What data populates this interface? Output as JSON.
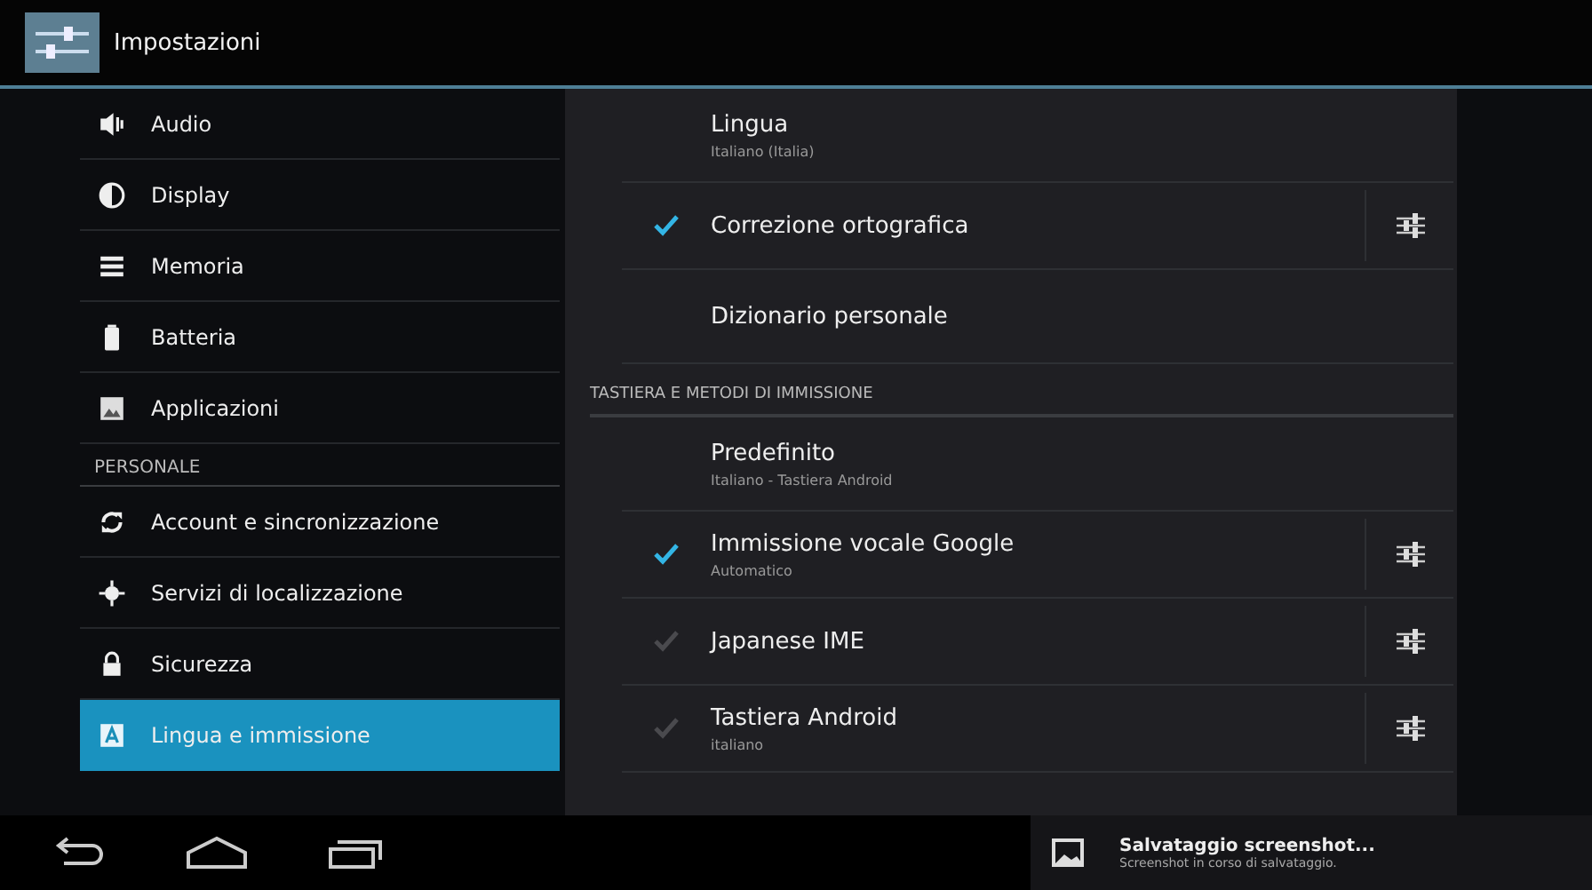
{
  "app_bar": {
    "title": "Impostazioni"
  },
  "sidebar": {
    "items": [
      {
        "kind": "item",
        "label": "Audio",
        "selected": false
      },
      {
        "kind": "item",
        "label": "Display",
        "selected": false
      },
      {
        "kind": "item",
        "label": "Memoria",
        "selected": false
      },
      {
        "kind": "item",
        "label": "Batteria",
        "selected": false
      },
      {
        "kind": "item",
        "label": "Applicazioni",
        "selected": false
      },
      {
        "kind": "header",
        "label": "PERSONALE"
      },
      {
        "kind": "item",
        "label": "Account e sincronizzazione",
        "selected": false
      },
      {
        "kind": "item",
        "label": "Servizi di localizzazione",
        "selected": false
      },
      {
        "kind": "item",
        "label": "Sicurezza",
        "selected": false
      },
      {
        "kind": "item",
        "label": "Lingua e immissione",
        "selected": true
      }
    ]
  },
  "detail": {
    "rows": [
      {
        "kind": "pref",
        "title": "Lingua",
        "summary": "Italiano (Italia)"
      },
      {
        "kind": "check",
        "title": "Correzione ortografica",
        "checked": true,
        "disabled": false
      },
      {
        "kind": "pref",
        "title": "Dizionario personale"
      },
      {
        "kind": "header",
        "title": "TASTIERA E METODI DI IMMISSIONE"
      },
      {
        "kind": "pref",
        "title": "Predefinito",
        "summary": "Italiano - Tastiera Android"
      },
      {
        "kind": "check",
        "title": "Immissione vocale Google",
        "summary": "Automatico",
        "checked": true,
        "disabled": false
      },
      {
        "kind": "check",
        "title": "Japanese IME",
        "checked": true,
        "disabled": true
      },
      {
        "kind": "check",
        "title": "Tastiera Android",
        "summary": "italiano",
        "checked": true,
        "disabled": true
      }
    ]
  },
  "notification": {
    "title": "Salvataggio screenshot...",
    "text": "Screenshot in corso di salvataggio."
  }
}
